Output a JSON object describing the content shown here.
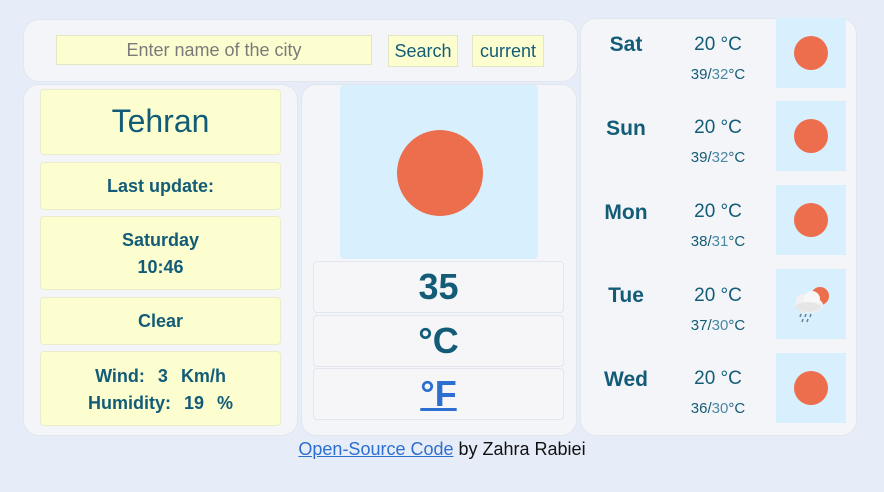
{
  "search": {
    "placeholder": "Enter name of the city",
    "search_label": "Search",
    "current_label": "current"
  },
  "current": {
    "city": "Tehran",
    "last_update_label": "Last update:",
    "day": "Saturday",
    "time": "10:46",
    "condition": "Clear",
    "wind_label": "Wind:",
    "wind_value": "3",
    "wind_unit": "Km/h",
    "humidity_label": "Humidity:",
    "humidity_value": "19",
    "humidity_unit": "%",
    "icon": "sun-icon",
    "temperature": "35",
    "unit_celsius": "°C",
    "unit_fahrenheit": "°F"
  },
  "forecast": [
    {
      "day": "Sat",
      "temp": "20 °C",
      "high": "39",
      "low": "32",
      "unit": "°C",
      "icon": "sun-icon"
    },
    {
      "day": "Sun",
      "temp": "20 °C",
      "high": "39",
      "low": "32",
      "unit": "°C",
      "icon": "sun-icon"
    },
    {
      "day": "Mon",
      "temp": "20 °C",
      "high": "38",
      "low": "31",
      "unit": "°C",
      "icon": "sun-icon"
    },
    {
      "day": "Tue",
      "temp": "20 °C",
      "high": "37",
      "low": "30",
      "unit": "°C",
      "icon": "rain-cloud-sun-icon"
    },
    {
      "day": "Wed",
      "temp": "20 °C",
      "high": "36",
      "low": "30",
      "unit": "°C",
      "icon": "sun-icon"
    }
  ],
  "footer": {
    "link_text": "Open-Source Code",
    "by_text": " by Zahra Rabiei"
  },
  "colors": {
    "page_background": "#e7edf8",
    "panel_background": "#f4f5f8",
    "box_yellow": "#fdfed0",
    "text_teal": "#135c78",
    "sun_orange": "#ec6e4c",
    "icon_background": "#d8effd",
    "link_blue": "#2c6fd1"
  }
}
